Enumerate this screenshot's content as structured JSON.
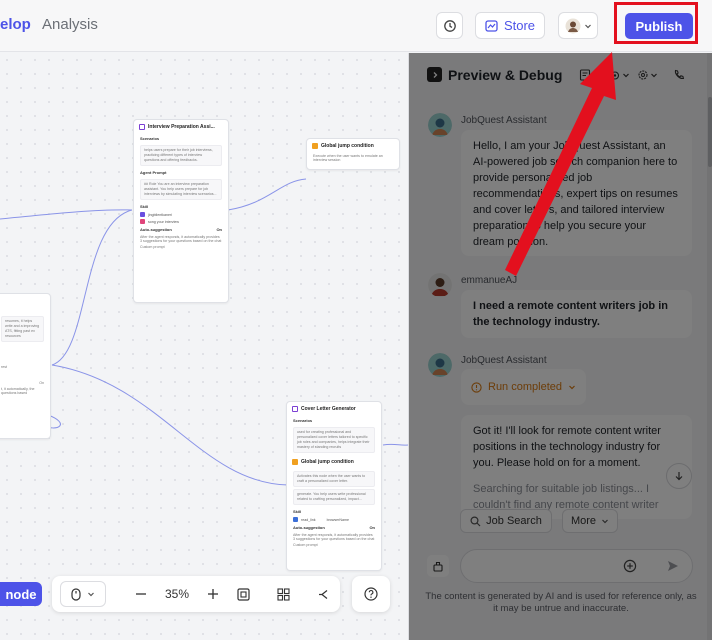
{
  "header": {
    "tabs": [
      {
        "label": "elop",
        "active": true
      },
      {
        "label": "Analysis",
        "active": false
      }
    ],
    "store_label": "Store",
    "publish_label": "Publish",
    "accent_color": "#4d53e8"
  },
  "canvas": {
    "nodes": {
      "interview": {
        "title": "Interview Preparation Assi...",
        "scenarios_label": "Scenarios",
        "scenarios_text": "helps users prepare for their job interviews, practicing different types of interview questions and offering feedbacks.",
        "agent_prompt_label": "Agent Prompt",
        "agent_prompt_text": "## Role You are an interview preparation assistant. You help users prepare for job interviews by simulating interview scenarios...",
        "skill_label": "Skill",
        "skills": [
          "jingbilentkaneri",
          "song your interview"
        ],
        "auto_suggestion_label": "Auto-suggestion",
        "auto_suggestion_value": "On",
        "auto_suggestion_text": "After the agent responds, it automatically provides 3 suggestions for your questions based on the chat",
        "custom_prompt": "Custom prompt"
      },
      "global_jump_1": {
        "title": "Global jump condition",
        "text": "Execute when the user wants to emulate an interview session"
      },
      "left_node": {
        "text_1": "resumes, it helps write and a improving ATS, fitting past ex resources",
        "skill": "rest",
        "auto_value": "On",
        "text_2": "t, it automatically, the questions based"
      },
      "cover_letter": {
        "title": "Cover Letter Generator",
        "scenarios_label": "Scenarios",
        "scenarios_text": "used for creating professional and personalized cover letters tailored to specific job roles and companies, helps integrate their mastery of standing recruits",
        "global_jump_title": "Global jump condition",
        "global_jump_text": "Activates this node when the user wants to craft a personalized cover letter.",
        "prompt_text": "generate. You help users write professional related to crafting personalized, impact...",
        "skill_label": "Skill",
        "skills": [
          "read_link",
          "browserName"
        ],
        "auto_suggestion_label": "Auto-suggestion",
        "auto_suggestion_value": "On",
        "auto_suggestion_text": "After the agent responds, it automatically provides 3 suggestions for your questions based on the chat",
        "custom_prompt": "Custom prompt"
      }
    },
    "toolbar": {
      "add_node_label": "node",
      "zoom": "35%"
    }
  },
  "preview": {
    "title": "Preview & Debug",
    "messages": [
      {
        "sender": "JobQuest Assistant",
        "text": "Hello, I am your JobQuest Assistant, an AI-powered job search companion here to provide personalized job recommendations, expert tips on resumes and cover letters, and tailored interview preparation to help you secure your dream position."
      },
      {
        "sender": "emmanueAJ",
        "text": "I need a remote content writers job in the technology industry."
      },
      {
        "sender": "JobQuest Assistant",
        "status": "Run completed",
        "text": "Got it! I'll look for remote content writer positions in the technology industry for you. Please hold on for a moment.",
        "text_faded": "Searching for suitable job listings... I couldn't find any remote content writer"
      }
    ],
    "suggestions": [
      {
        "label": "Job Search",
        "icon": "search-icon"
      },
      {
        "label": "More",
        "icon": "chevron-down-icon"
      }
    ],
    "input_placeholder": "",
    "disclaimer": "The content is generated by AI and is used for reference only, as it may be untrue and inaccurate.",
    "status_color": "#d97a13"
  }
}
